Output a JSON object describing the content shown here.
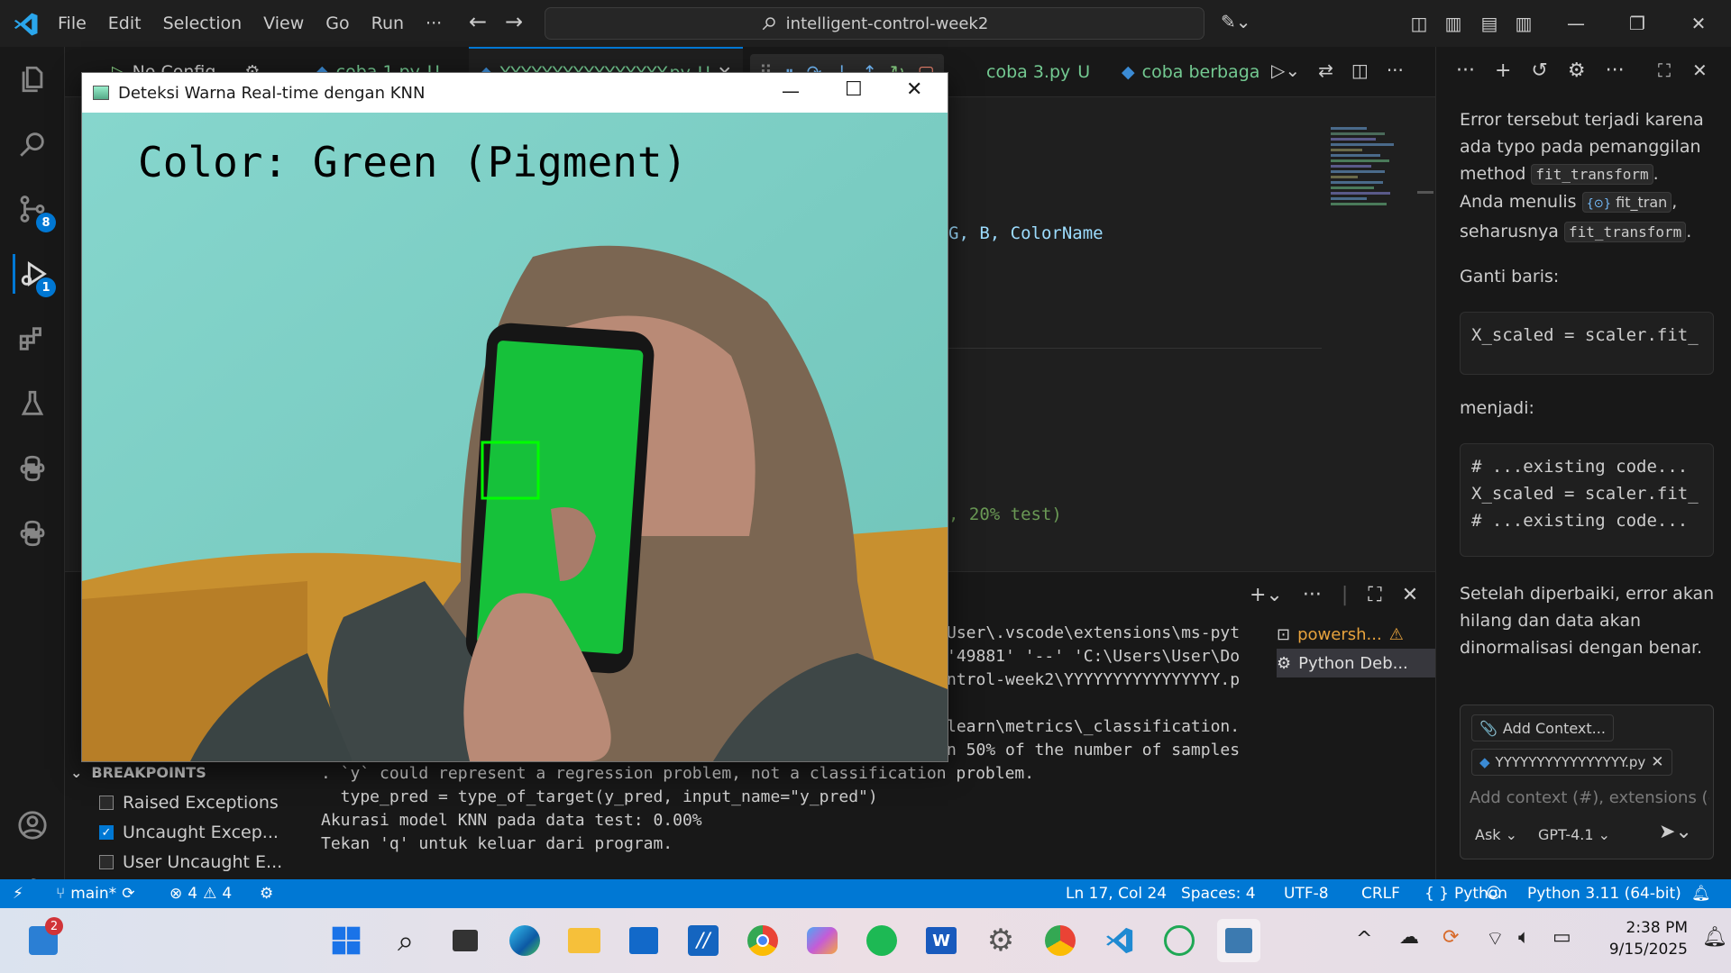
{
  "menu": [
    "File",
    "Edit",
    "Selection",
    "View",
    "Go",
    "Run",
    "···"
  ],
  "search": {
    "label": "intelligent-control-week2"
  },
  "activity": {
    "scm_badge": "8",
    "debug_badge": "1"
  },
  "tabs": {
    "debug_config": "No Config",
    "tab1": "coba 1.py",
    "tab1_status": "U",
    "tab2": "YYYYYYYYYYYYYYYY.py",
    "tab2_status": "U",
    "tab3": "coba 3.py",
    "tab3_status": "U",
    "tab4": "coba berbaga"
  },
  "editor": {
    "line_a": "G, B, ColorName",
    "line_b": ", 20% test)"
  },
  "panel": {
    "term_lines_right": [
      "User\\.vscode\\extensions\\ms-pyt",
      "'49881' '--' 'C:\\Users\\User\\Do",
      "ntrol-week2\\YYYYYYYYYYYYYYYY.p",
      "",
      "learn\\metrics\\_classification.",
      "n 50% of the number of samples"
    ],
    "term_lines_full": [
      ". `y` could represent a regression problem, not a classification problem.",
      "  type_pred = type_of_target(y_pred, input_name=\"y_pred\")",
      "Akurasi model KNN pada data test: 0.00%",
      "Tekan 'q' untuk keluar dari program."
    ],
    "terminals": [
      "powersh...",
      "Python Deb..."
    ]
  },
  "breakpoints": {
    "title": "BREAKPOINTS",
    "items": [
      {
        "label": "Raised Exceptions",
        "checked": false
      },
      {
        "label": "Uncaught Excep...",
        "checked": true
      },
      {
        "label": "User Uncaught E...",
        "checked": false
      }
    ]
  },
  "chat": {
    "p1_a": "Error tersebut terjadi karena ada typo pada pemanggilan method",
    "p1_code": "fit_transform",
    "p1_b": "Anda menulis",
    "p1_ref": "fit_tran",
    "p1_c": "seharusnya",
    "p1_code2": "fit_transform",
    "p2": "Ganti baris:",
    "block1": "X_scaled = scaler.fit_",
    "p3": "menjadi:",
    "block2": "# ...existing code...\nX_scaled = scaler.fit_\n# ...existing code...",
    "p4": "Setelah diperbaiki, error akan hilang dan data akan dinormalisasi dengan benar.",
    "add_context": "Add Context...",
    "context_file": "YYYYYYYYYYYYYYYY.py",
    "input_placeholder": "Add context (#), extensions (@",
    "mode": "Ask",
    "model": "GPT-4.1"
  },
  "cvwindow": {
    "title": "Deteksi Warna Real-time dengan KNN",
    "overlay_text": "Color: Green (Pigment)"
  },
  "status": {
    "branch": "main*",
    "errors": "4",
    "warnings": "4",
    "position": "Ln 17, Col 24",
    "spaces": "Spaces: 4",
    "encoding": "UTF-8",
    "eol": "CRLF",
    "language": "Python",
    "interpreter": "Python 3.11 (64-bit)"
  },
  "taskbar": {
    "notif_badge": "2",
    "time": "2:38 PM",
    "date": "9/15/2025"
  },
  "colors": {
    "accent": "#0078d4",
    "bg": "#1f1f1f",
    "green_detect": "#00ff00"
  }
}
